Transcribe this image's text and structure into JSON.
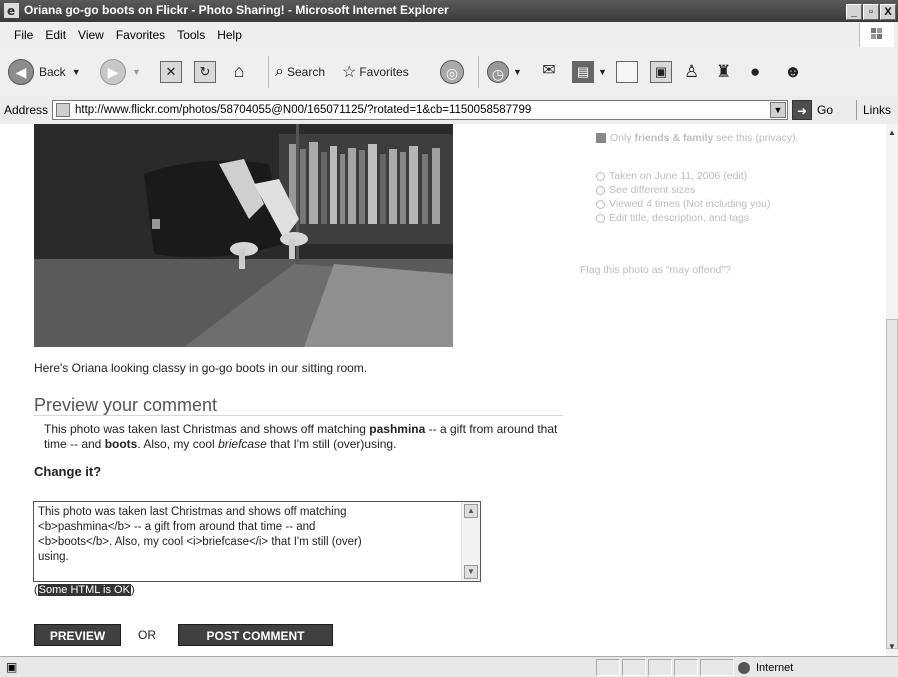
{
  "window": {
    "title": "Oriana go-go boots on Flickr - Photo Sharing! - Microsoft Internet Explorer",
    "controls": [
      "_",
      "̈",
      "X"
    ]
  },
  "menu": [
    "File",
    "Edit",
    "View",
    "Favorites",
    "Tools",
    "Help"
  ],
  "toolbar": {
    "back": "Back",
    "search": "Search",
    "favorites": "Favorites"
  },
  "address": {
    "label": "Address",
    "url": "http://www.flickr.com/photos/58704055@N00/165071125/?rotated=1&cb=1150058587799",
    "go": "Go",
    "links": "Links"
  },
  "photo": {
    "caption": "Here's Oriana looking classy in go-go boots in our sitting room."
  },
  "preview": {
    "heading": "Preview your comment",
    "p1": "This photo was taken last Christmas and shows off matching ",
    "b1": "pashmina",
    "p2": " -- a gift from around that time -- and ",
    "b2": "boots",
    "p3": ". Also, my cool ",
    "i1": "briefcase",
    "p4": " that I'm still (over)using."
  },
  "change": {
    "label": "Change it?",
    "text_l1": "This photo was taken last Christmas and shows off matching",
    "text_l2": "<b>pashmina</b> -- a gift from around that time -- and",
    "text_l3": "<b>boots</b>. Also, my cool <i>briefcase</i> that I'm still (over)",
    "text_l4": "using.",
    "html_ok_open": "(",
    "html_ok": "Some HTML is OK",
    "html_ok_close": ")"
  },
  "buttons": {
    "preview": "PREVIEW",
    "or": "OR",
    "post": "POST COMMENT"
  },
  "sidebar": {
    "privacy_pre": "Only ",
    "privacy_bold": "friends & family",
    "privacy_post": " see this (privacy).",
    "taken": "Taken on June 11, 2006 (edit)",
    "sizes": "See different sizes",
    "viewed": "Viewed 4 times   (Not including you)",
    "edit": "Edit title, description, and tags",
    "flag": "Flag this photo as \"may offend\"?"
  },
  "status": {
    "zone": "Internet"
  }
}
